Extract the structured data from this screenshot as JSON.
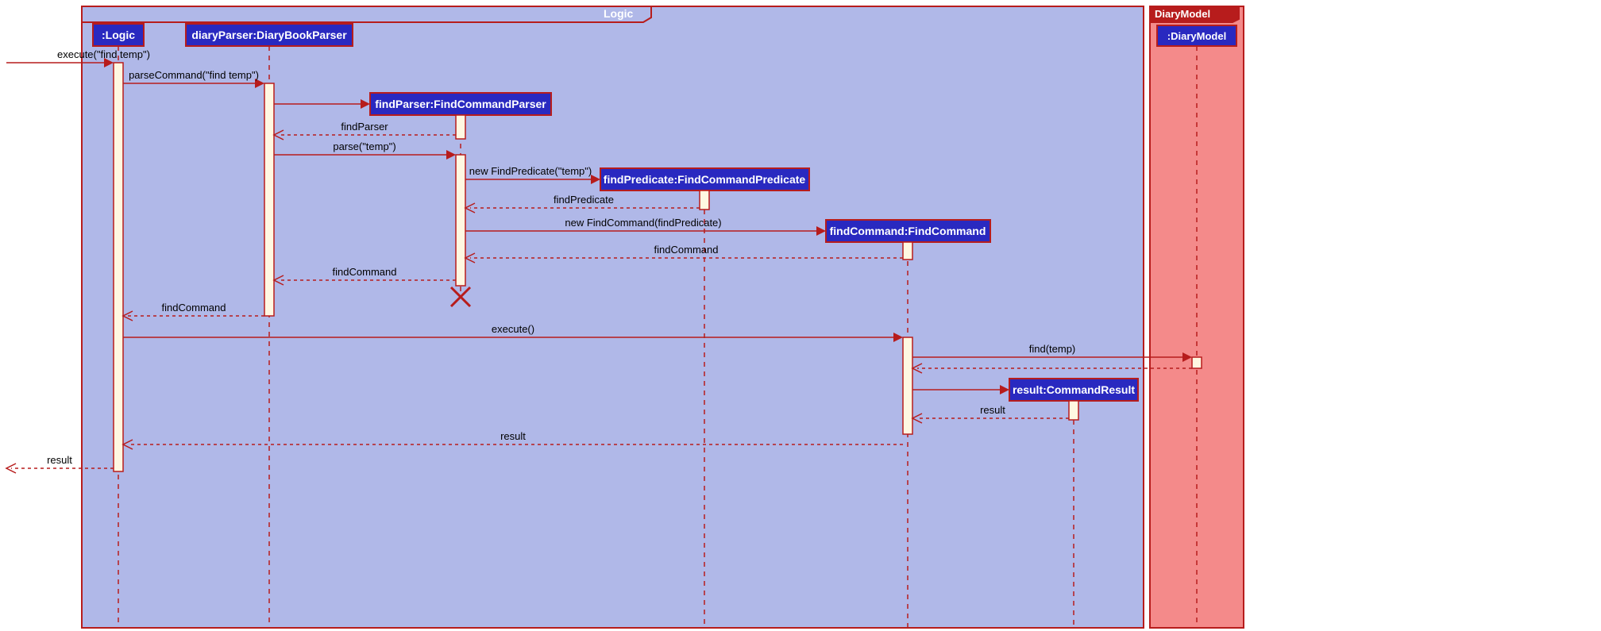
{
  "frames": {
    "logic": {
      "label": "Logic"
    },
    "model": {
      "label": "DiaryModel"
    }
  },
  "lifelines": {
    "logic": ":Logic",
    "diaryParser": "diaryParser:DiaryBookParser",
    "findParser": "findParser:FindCommandParser",
    "findPredicate": "findPredicate:FindCommandPredicate",
    "findCommand": "findCommand:FindCommand",
    "result": "result:CommandResult",
    "diaryModel": ":DiaryModel"
  },
  "messages": {
    "m1": "execute(\"find temp\")",
    "m2": "parseCommand(\"find temp\")",
    "m3": "findParser",
    "m4": "parse(\"temp\")",
    "m5": "new FindPredicate(\"temp\")",
    "m6": "findPredicate",
    "m7": "new FindCommand(findPredicate)",
    "m8": "findCommand",
    "m9": "findCommand",
    "m10": "findCommand",
    "m11": "execute()",
    "m12": "find(temp)",
    "m13": "result",
    "m14": "result",
    "m15": "result"
  }
}
